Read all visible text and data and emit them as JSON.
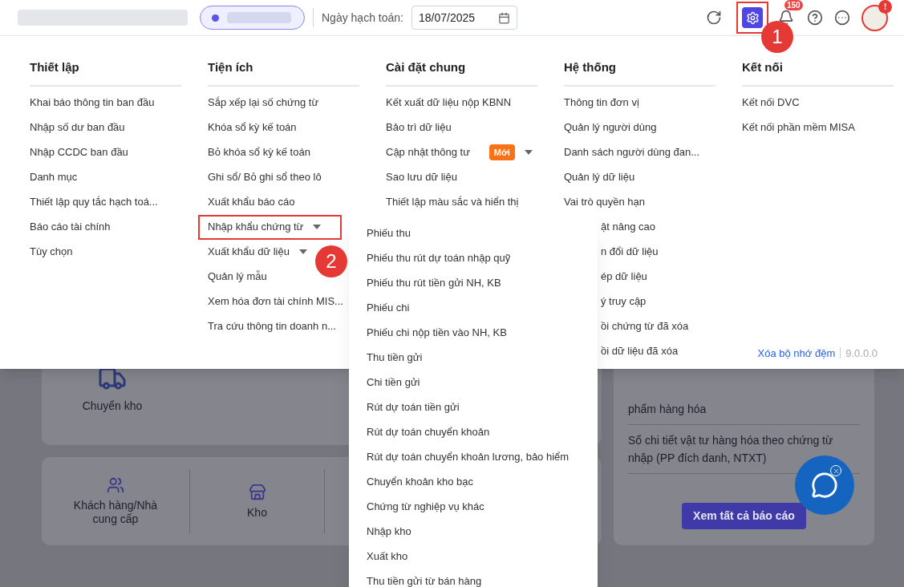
{
  "topbar": {
    "date_label": "Ngày hạch toán:",
    "date_value": "18/07/2025",
    "settings_highlighted": true,
    "notification_count": "150",
    "avatar_alert": "!"
  },
  "menu": {
    "columns": [
      {
        "title": "Thiết lập",
        "items": [
          {
            "label": "Khai báo thông tin ban đầu",
            "kind": "link",
            "highlighted": false
          },
          {
            "label": "Nhập số dư ban đầu",
            "kind": "link",
            "highlighted": false
          },
          {
            "label": "Nhập CCDC ban đầu",
            "kind": "link",
            "highlighted": false
          },
          {
            "label": "Danh mục",
            "kind": "link",
            "highlighted": false
          },
          {
            "label": "Thiết lập quy tắc hạch toá...",
            "kind": "link",
            "highlighted": false
          },
          {
            "label": "Báo cáo tài chính",
            "kind": "link",
            "highlighted": false
          },
          {
            "label": "Tùy chọn",
            "kind": "link",
            "highlighted": false
          }
        ]
      },
      {
        "title": "Tiện ích",
        "items": [
          {
            "label": "Sắp xếp lại số chứng từ",
            "kind": "link",
            "highlighted": false
          },
          {
            "label": "Khóa sổ kỳ kế toán",
            "kind": "link",
            "highlighted": false
          },
          {
            "label": "Bỏ khóa sổ kỳ kế toán",
            "kind": "link",
            "highlighted": false
          },
          {
            "label": "Ghi sổ/ Bỏ ghi sổ theo lô",
            "kind": "link",
            "highlighted": false
          },
          {
            "label": "Xuất khẩu báo cáo",
            "kind": "link",
            "highlighted": false
          },
          {
            "label": "Nhập khẩu chứng từ",
            "kind": "submenu",
            "highlighted": true
          },
          {
            "label": "Xuất khẩu dữ liệu",
            "kind": "submenu",
            "highlighted": false
          },
          {
            "label": "Quản lý mẫu",
            "kind": "link",
            "highlighted": false
          },
          {
            "label": "Xem hóa đơn tài chính MIS...",
            "kind": "link",
            "highlighted": false
          },
          {
            "label": "Tra cứu thông tin doanh n...",
            "kind": "link",
            "highlighted": false
          }
        ]
      },
      {
        "title": "Cài đặt chung",
        "items": [
          {
            "label": "Kết xuất dữ liệu nộp KBNN",
            "kind": "link",
            "highlighted": false
          },
          {
            "label": "Bảo trì dữ liệu",
            "kind": "link",
            "highlighted": false
          },
          {
            "label": "Cập nhật thông tư",
            "kind": "submenu",
            "badge": "Mới",
            "highlighted": false
          },
          {
            "label": "Sao lưu dữ liệu",
            "kind": "link",
            "highlighted": false
          },
          {
            "label": "Thiết lập màu sắc và hiển thị",
            "kind": "link",
            "highlighted": false
          }
        ]
      },
      {
        "title": "Hệ thống",
        "items": [
          {
            "label": "Thông tin đơn vị",
            "kind": "link",
            "highlighted": false
          },
          {
            "label": "Quản lý người dùng",
            "kind": "link",
            "highlighted": false
          },
          {
            "label": "Danh sách người dùng đan...",
            "kind": "link",
            "highlighted": false
          },
          {
            "label": "Quản lý dữ liệu",
            "kind": "link",
            "highlighted": false
          },
          {
            "label": "Vai trò quyền hạn",
            "kind": "link",
            "highlighted": false
          },
          {
            "label": "ật nâng cao",
            "kind": "partial",
            "highlighted": false
          },
          {
            "label": "n đổi dữ liệu",
            "kind": "partial",
            "highlighted": false
          },
          {
            "label": "ép dữ liệu",
            "kind": "partial",
            "highlighted": false
          },
          {
            "label": "ý truy cập",
            "kind": "partial",
            "highlighted": false
          },
          {
            "label": "ồi chứng từ đã xóa",
            "kind": "partial",
            "highlighted": false
          },
          {
            "label": "ồi dữ liệu đã xóa",
            "kind": "partial",
            "highlighted": false
          }
        ]
      },
      {
        "title": "Kết nối",
        "items": [
          {
            "label": "Kết nối DVC",
            "kind": "link",
            "highlighted": false
          },
          {
            "label": "Kết nối phần mềm MISA",
            "kind": "link",
            "highlighted": false
          }
        ]
      }
    ],
    "footer": {
      "link": "Xóa bộ nhớ đệm",
      "version": "9.0.0.0"
    }
  },
  "submenu": [
    "Phiếu thu",
    "Phiếu thu rút dự toán nhập quỹ",
    "Phiếu thu rút tiền gửi NH, KB",
    "Phiếu chi",
    "Phiếu chi nộp tiền vào NH, KB",
    "Thu tiền gửi",
    "Chi tiền gửi",
    "Rút dự toán tiền gửi",
    "Rút dự toán chuyển khoản",
    "Rút dự toán chuyển khoản lương, bảo hiểm",
    "Chuyển khoản kho bạc",
    "Chứng từ nghiệp vụ khác",
    "Nhập kho",
    "Xuất kho",
    "Thu tiền gửi từ bán hàng"
  ],
  "callouts": [
    "1",
    "2"
  ],
  "background": {
    "shortcut": "Chuyển kho",
    "categories": [
      {
        "label": "Khách hàng/Nhà cung cấp",
        "kind": "people"
      },
      {
        "label": "Kho",
        "kind": "store"
      }
    ],
    "reports": [
      "phẩm hàng hóa",
      "Sổ chi tiết vật tư hàng hóa theo chứng từ nhập (PP đích danh, NTXT)"
    ],
    "report_button": "Xem tất cả báo cáo"
  }
}
